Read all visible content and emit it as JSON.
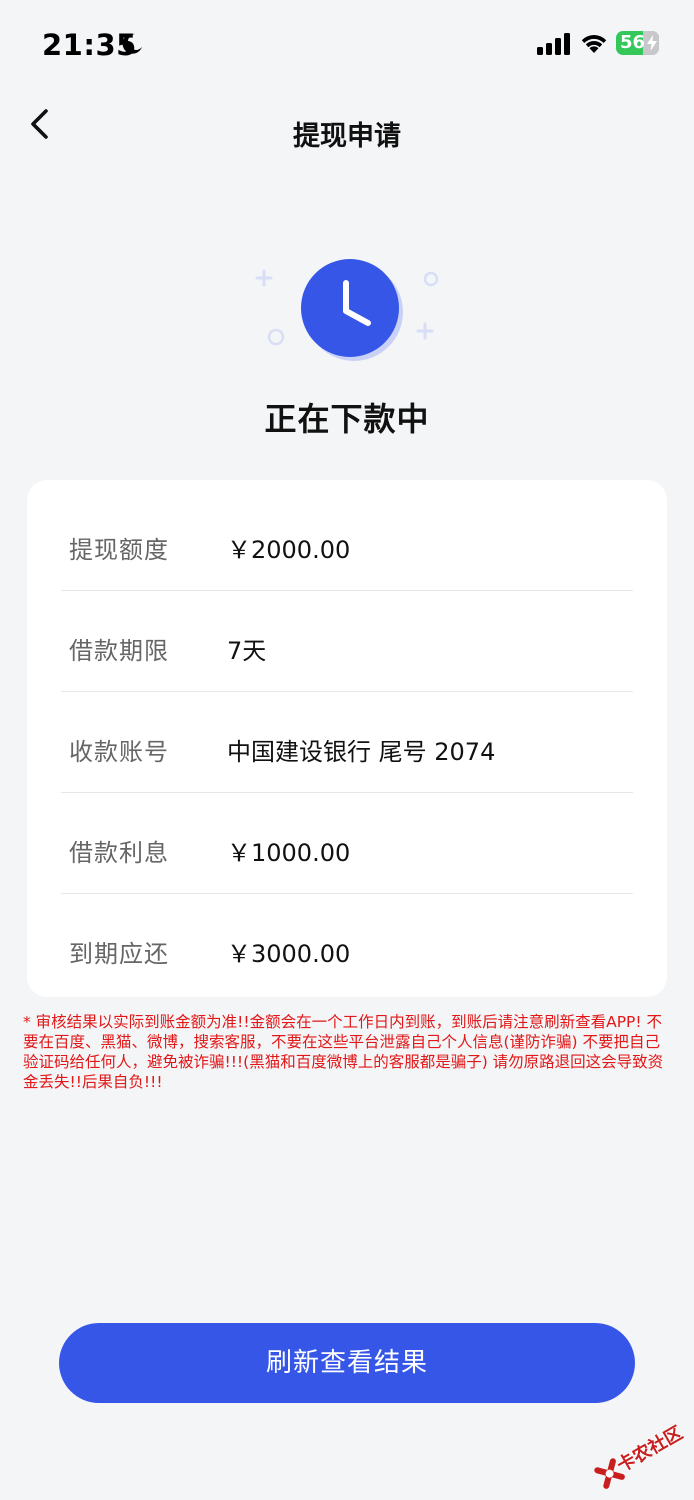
{
  "status_bar": {
    "time": "21:35",
    "battery": "56"
  },
  "nav": {
    "title": "提现申请"
  },
  "status": {
    "title": "正在下款中"
  },
  "details": [
    {
      "label": "提现额度",
      "value": "￥2000.00"
    },
    {
      "label": "借款期限",
      "value": "7天"
    },
    {
      "label": "收款账号",
      "value": "中国建设银行 尾号 2074"
    },
    {
      "label": "借款利息",
      "value": "￥1000.00"
    },
    {
      "label": "到期应还",
      "value": "￥3000.00"
    }
  ],
  "notice": "* 审核结果以实际到账金额为准!!金额会在一个工作日内到账，到账后请注意刷新查看APP! 不要在百度、黑猫、微博，搜索客服，不要在这些平台泄露自己个人信息(谨防诈骗) 不要把自己验证码给任何人，避免被诈骗!!!(黑猫和百度微博上的客服都是骗子) 请勿原路退回这会导致资金丢失!!后果自负!!!",
  "button": {
    "label": "刷新查看结果"
  },
  "watermark": {
    "text": "卡农社区"
  },
  "colors": {
    "primary": "#3656e8",
    "warning": "#e21818",
    "background": "#f4f5f7"
  }
}
